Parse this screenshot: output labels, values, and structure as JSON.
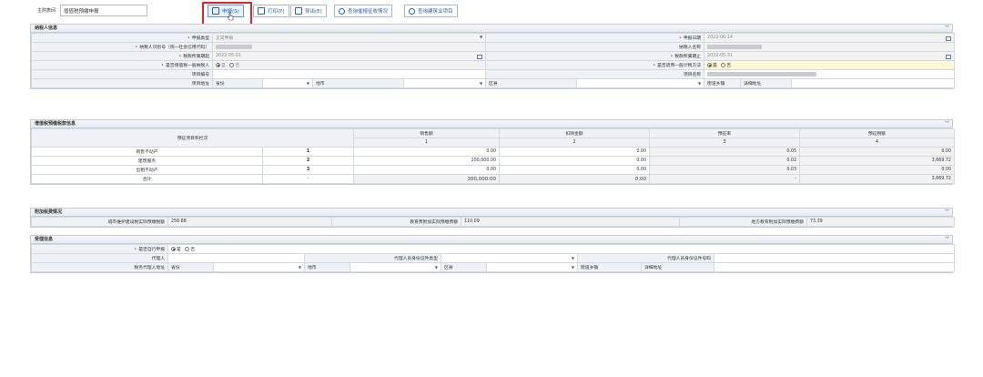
{
  "toolbar": {
    "title_label": "主附表间",
    "title_value": "增值税预缴申报",
    "buttons": [
      {
        "label": "申报(S)",
        "icon": "save-icon"
      },
      {
        "label": "打印(P)",
        "icon": "print-icon"
      },
      {
        "label": "导出(E)",
        "icon": "export-icon"
      },
      {
        "label": "查询催报征收情况",
        "icon": "search-icon"
      },
      {
        "label": "查询建筑业项目",
        "icon": "search-icon"
      }
    ]
  },
  "taxpayer": {
    "section_title": "纳税人信息",
    "report_type_label": "申报类型",
    "report_type_value": "正常申报",
    "report_date_label": "申报日期",
    "report_date_value": "2022-06-14",
    "taxpayer_id_label": "纳税人识别号（统一社会信用代码）",
    "taxpayer_name_label": "纳税人名称",
    "period_start_label": "税款所属期起",
    "period_start_value": "2022-05-01",
    "period_end_label": "税款所属期止",
    "period_end_value": "2022-05-31",
    "general_taxpayer_label": "是否增值税一般纳税人",
    "general_taxpayer_options": [
      "是",
      "否"
    ],
    "simple_method_label": "是否适用一般计税方法",
    "simple_method_options": [
      "是",
      "否"
    ],
    "project_no_label": "项目编号",
    "project_name_label": "项目名称",
    "project_addr_label": "项目地址",
    "province_label": "省份",
    "city_label": "地市",
    "county_label": "区县",
    "street_label": "街道乡镇",
    "detail_addr_label": "详细地址"
  },
  "prepay": {
    "section_title": "增值税预缴税款信息",
    "row_header": "预征项目和栏次",
    "columns": [
      "销售额",
      "扣除金额",
      "预征率",
      "预征税额"
    ],
    "column_numbers": [
      "1",
      "2",
      "3",
      "4"
    ],
    "rows": [
      {
        "name": "销售不动产",
        "no": "1",
        "sales": "0.00",
        "deduct": "0.00",
        "rate": "0.05",
        "tax": "0.00"
      },
      {
        "name": "建筑服务",
        "no": "2",
        "sales": "200,000.00",
        "deduct": "0.00",
        "rate": "0.02",
        "tax": "3,669.72"
      },
      {
        "name": "出租不动产",
        "no": "3",
        "sales": "0.00",
        "deduct": "0.00",
        "rate": "0.03",
        "tax": "0.00"
      },
      {
        "name": "合计",
        "no": "-",
        "sales": "200,000.00",
        "deduct": "0.00",
        "rate": "-",
        "tax": "3,669.72"
      }
    ]
  },
  "surcharge": {
    "section_title": "附加税费情况",
    "city_tax_label": "城市维护建设税实际预缴税额",
    "city_tax_value": "256.88",
    "edu_label": "教育费附加实际预缴费额",
    "edu_value": "110.09",
    "local_edu_label": "地方教育附加实际预缴费额",
    "local_edu_value": "73.39"
  },
  "agent": {
    "section_title": "受理信息",
    "self_declare_label": "是否自行申报",
    "self_declare_options": [
      "是",
      "否"
    ],
    "agent_label": "代理人",
    "agent_id_type_label": "代理人员身份证件类型",
    "agent_id_no_label": "代理人员身份证件号码",
    "agent_addr_label": "税务代理人地址",
    "province_label": "省份",
    "city_label": "地市",
    "county_label": "区县",
    "street_label": "街道乡镇",
    "detail_addr_label": "详细地址"
  },
  "colors": {
    "accent": "#2a63a8",
    "highlight": "#e0242b",
    "header_bg": "#eef1f5",
    "yellow": "#fdf8d8"
  }
}
